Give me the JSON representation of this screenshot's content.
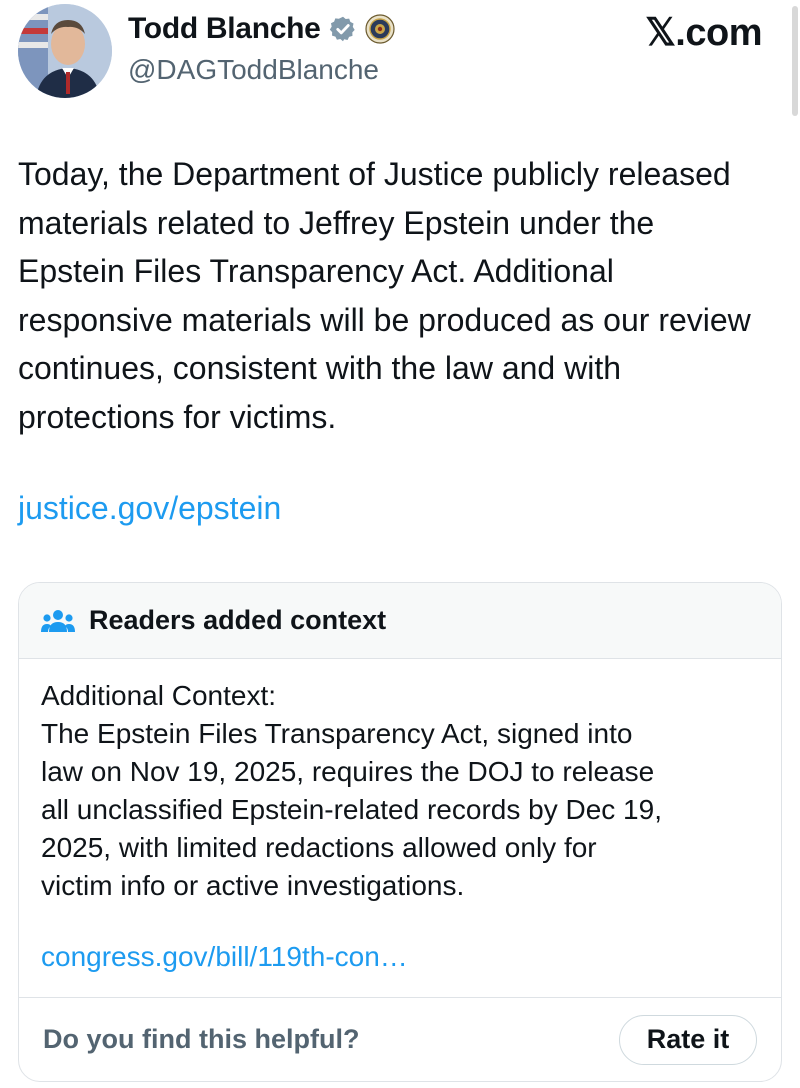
{
  "author": {
    "name": "Todd Blanche",
    "handle": "@DAGToddBlanche"
  },
  "brand": "𝕏.com",
  "tweet": {
    "text": "Today, the Department of Justice publicly released materials related to Jeffrey Epstein under the Epstein Files Transparency Act. Additional responsive materials will be produced as our review continues, consistent with the law and with protections for victims.",
    "link": "justice.gov/epstein"
  },
  "community_note": {
    "title": "Readers added context",
    "lines": [
      "Additional Context:",
      "The Epstein Files Transparency Act, signed into",
      "law on Nov 19, 2025, requires the DOJ to release",
      "all unclassified Epstein-related records by Dec 19,",
      "2025, with limited redactions allowed only for",
      "victim info or active investigations."
    ],
    "link": "congress.gov/bill/119th-con…",
    "question": "Do you find this helpful?",
    "rate_label": "Rate it"
  },
  "colors": {
    "link": "#1d9bf0",
    "verified": "#829aab",
    "secondary_text": "#536471"
  },
  "icons": {
    "verified": "verified-badge-icon",
    "affiliation": "doj-seal-icon",
    "note": "people-icon"
  }
}
